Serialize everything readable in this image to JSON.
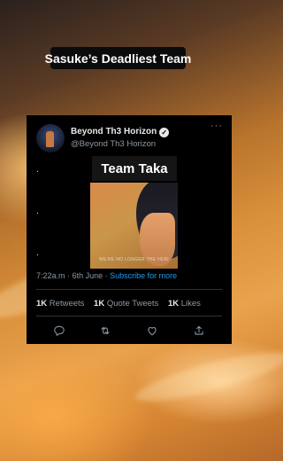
{
  "video": {
    "title": "Sasuke’s Deadliest Team"
  },
  "tweet": {
    "display_name": "Beyond Th3 Horizon",
    "handle": "@Beyond Th3 Horizon",
    "body_lines": [
      ".",
      ".",
      "."
    ],
    "media_label": "Team Taka",
    "media_subtitle": "WE'RE NO LONGER THE HEBI",
    "time": "7:22a.m",
    "date": "6th June",
    "separator": "·",
    "subscribe_link": "Subscribe for more",
    "stats": {
      "retweets_count": "1K",
      "retweets_label": "Retweets",
      "quote_count": "1K",
      "quote_label": "Quote Tweets",
      "likes_count": "1K",
      "likes_label": "Likes"
    },
    "more_label": "···",
    "icons": [
      "reply-icon",
      "retweet-icon",
      "like-icon",
      "share-icon"
    ]
  },
  "colors": {
    "card_bg": "#000000",
    "text": "#e7e9ea",
    "muted": "#8b98a5",
    "link": "#1d9bf0"
  }
}
